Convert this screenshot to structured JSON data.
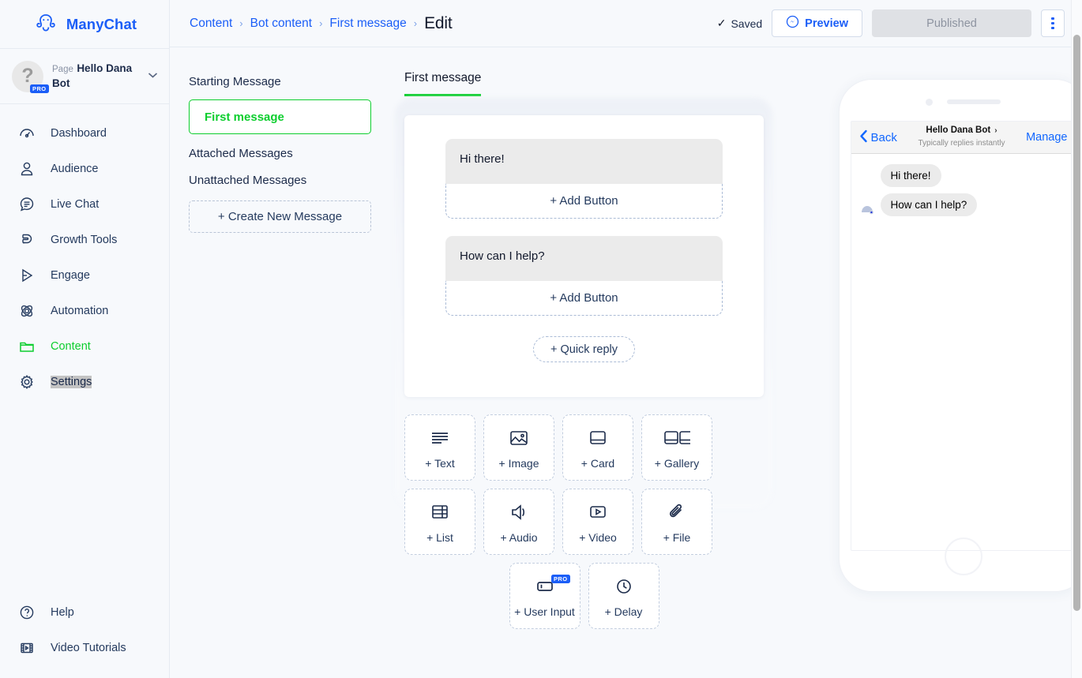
{
  "brand": {
    "name": "ManyChat",
    "logo_icon": "manychat-octopus-logo"
  },
  "account": {
    "label": "Page",
    "name": "Hello Dana Bot",
    "badge": "PRO",
    "avatar_icon": "question-mark-avatar",
    "chevron_icon": "chevron-down-icon"
  },
  "sidebar": {
    "items": [
      {
        "label": "Dashboard",
        "icon": "gauge-icon",
        "active": false
      },
      {
        "label": "Audience",
        "icon": "person-icon",
        "active": false
      },
      {
        "label": "Live Chat",
        "icon": "chat-bubble-icon",
        "active": false
      },
      {
        "label": "Growth Tools",
        "icon": "magnet-icon",
        "active": false
      },
      {
        "label": "Engage",
        "icon": "send-arrow-icon",
        "active": false
      },
      {
        "label": "Automation",
        "icon": "atom-icon",
        "active": false
      },
      {
        "label": "Content",
        "icon": "folder-icon",
        "active": true
      },
      {
        "label": "Settings",
        "icon": "gear-icon",
        "active": false,
        "selected": true
      }
    ],
    "bottom_items": [
      {
        "label": "Help",
        "icon": "question-circle-icon"
      },
      {
        "label": "Video Tutorials",
        "icon": "film-icon"
      }
    ]
  },
  "header": {
    "breadcrumbs": [
      "Content",
      "Bot content",
      "First message"
    ],
    "current": "Edit",
    "separator": "›",
    "saved_label": "Saved",
    "saved_icon": "check-icon",
    "preview_label": "Preview",
    "preview_icon": "messenger-icon",
    "published_label": "Published",
    "more_icon": "vertical-dots-icon"
  },
  "messages_column": {
    "starting_title": "Starting Message",
    "selected_message": "First message",
    "links": [
      "Attached Messages",
      "Unattached Messages"
    ],
    "create_label": "+ Create New Message"
  },
  "editor": {
    "tab_label": "First message",
    "blocks": [
      {
        "text": "Hi there!",
        "add_button_label": "+ Add Button"
      },
      {
        "text": "How can I help?",
        "add_button_label": "+ Add Button"
      }
    ],
    "quick_reply_label": "+ Quick reply"
  },
  "tiles": {
    "row1": [
      {
        "label": "+ Text",
        "icon": "text-lines-icon"
      },
      {
        "label": "+ Image",
        "icon": "image-icon"
      },
      {
        "label": "+ Card",
        "icon": "card-icon"
      },
      {
        "label": "+ Gallery",
        "icon": "gallery-icon"
      }
    ],
    "row2": [
      {
        "label": "+ List",
        "icon": "list-table-icon"
      },
      {
        "label": "+ Audio",
        "icon": "speaker-icon"
      },
      {
        "label": "+ Video",
        "icon": "video-play-icon"
      },
      {
        "label": "+ File",
        "icon": "paperclip-icon"
      }
    ],
    "row3": [
      {
        "label": "+ User Input",
        "icon": "input-field-icon",
        "badge": "PRO"
      },
      {
        "label": "+ Delay",
        "icon": "clock-icon"
      }
    ]
  },
  "preview": {
    "back_label": "Back",
    "back_icon": "chevron-left-icon",
    "bot_name": "Hello Dana Bot",
    "name_chevron": "›",
    "subtitle": "Typically replies instantly",
    "manage_label": "Manage",
    "chat_bubbles": [
      "Hi there!",
      "How can I help?"
    ],
    "avatar_icon": "bot-avatar-icon"
  },
  "colors": {
    "brand_blue": "#1b5ef7",
    "accent_green": "#0dce2e",
    "link_blue": "#1267ff",
    "bubble_gray": "#ebebeb",
    "canvas": "#f7f9fc"
  }
}
